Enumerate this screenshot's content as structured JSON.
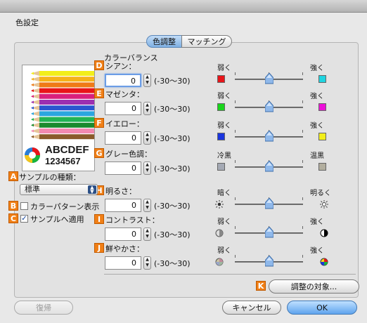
{
  "window": {
    "title": "色設定"
  },
  "tabs": [
    {
      "label": "色調整",
      "selected": true
    },
    {
      "label": "マッチング",
      "selected": false
    }
  ],
  "sample_image": {
    "text_line1": "ABCDEF",
    "text_line2": "1234567"
  },
  "color_balance": {
    "heading": "カラーバランス",
    "range_text": "(-30〜30)",
    "rows": [
      {
        "marker": "D",
        "label": "シアン：",
        "value": "0",
        "low": "弱く",
        "high": "強く",
        "low_color": "#e8151a",
        "high_color": "#1fd4e0",
        "slider_value": 0
      },
      {
        "marker": "E",
        "label": "マゼンタ：",
        "value": "0",
        "low": "弱く",
        "high": "強く",
        "low_color": "#19d41b",
        "high_color": "#ec10d8",
        "slider_value": 0
      },
      {
        "marker": "F",
        "label": "イエロー：",
        "value": "0",
        "low": "弱く",
        "high": "強く",
        "low_color": "#1a35de",
        "high_color": "#f2ee1a",
        "slider_value": 0
      },
      {
        "marker": "G",
        "label": "グレー色調：",
        "value": "0",
        "low": "冷黒",
        "high": "温黒",
        "low_color": "#a4a9b4",
        "high_color": "#b2ae9e",
        "slider_value": 0
      }
    ]
  },
  "adjustments": {
    "range_text": "(-30〜30)",
    "rows": [
      {
        "marker": "H",
        "label": "明るさ：",
        "value": "0",
        "low": "暗く",
        "high": "明るく",
        "low_icon": "sun-dark-icon",
        "high_icon": "sun-bright-icon",
        "slider_value": 0
      },
      {
        "marker": "I",
        "label": "コントラスト：",
        "value": "0",
        "low": "弱く",
        "high": "強く",
        "low_icon": "contrast-low-icon",
        "high_icon": "contrast-high-icon",
        "slider_value": 0
      },
      {
        "marker": "J",
        "label": "鮮やかさ：",
        "value": "0",
        "low": "弱く",
        "high": "強く",
        "low_icon": "saturation-low-icon",
        "high_icon": "saturation-high-icon",
        "slider_value": 0
      }
    ]
  },
  "sample_type": {
    "marker": "A",
    "label": "サンプルの種類：",
    "selected": "標準"
  },
  "color_pattern": {
    "marker": "B",
    "label": "カラーパターン表示",
    "checked": false
  },
  "apply_sample": {
    "marker": "C",
    "label": "サンプルへ適用",
    "checked": true
  },
  "adjust_target": {
    "marker": "K",
    "label": "調整の対象..."
  },
  "buttons": {
    "restore": "復帰",
    "cancel": "キャンセル",
    "ok": "OK"
  }
}
